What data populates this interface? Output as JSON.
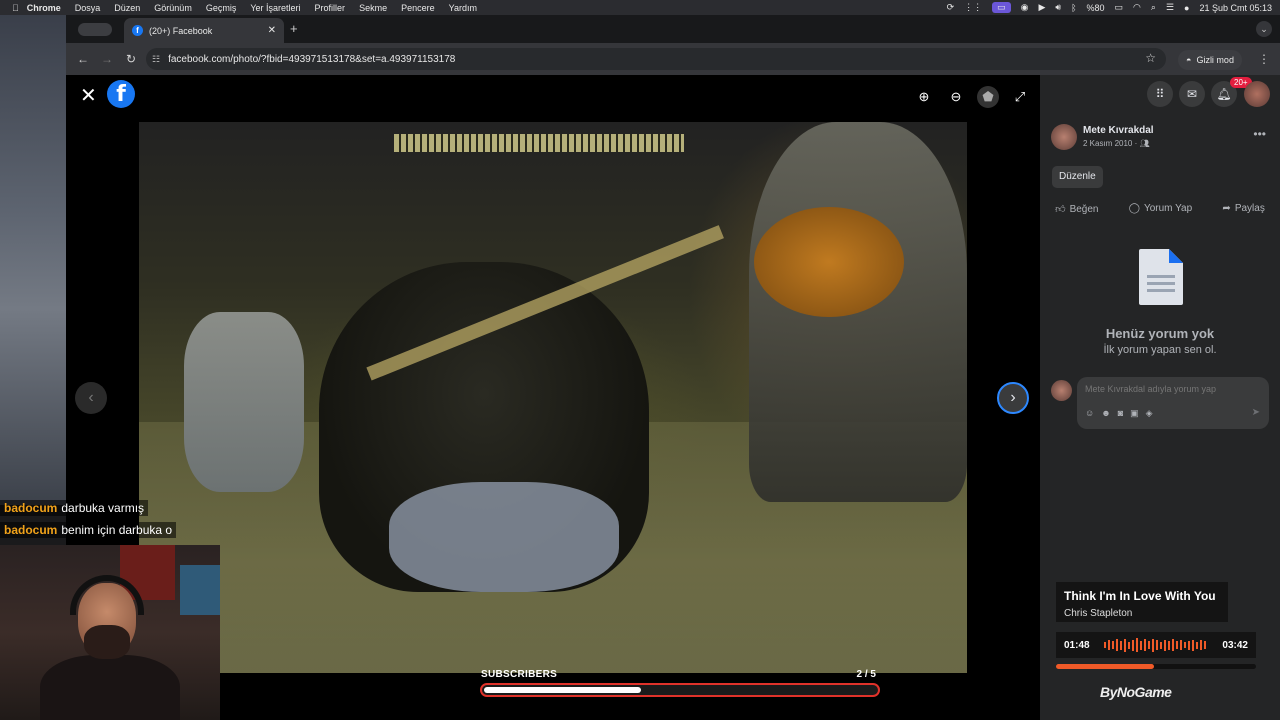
{
  "menubar": {
    "app": "Chrome",
    "items": [
      "Dosya",
      "Düzen",
      "Görünüm",
      "Geçmiş",
      "Yer İşaretleri",
      "Profiller",
      "Sekme",
      "Pencere",
      "Yardım"
    ],
    "battery": "%80",
    "datetime": "21 Şub Cmt  05:13"
  },
  "browser": {
    "tab_title": "(20+) Facebook",
    "url": "facebook.com/photo/?fbid=493971513178&set=a.493971153178",
    "incognito_label": "Gizli mod"
  },
  "post": {
    "author": "Mete Kıvrakdal",
    "date": "2 Kasım 2010 ·",
    "edit_label": "Düzenle",
    "like_label": "Beğen",
    "comment_label": "Yorum Yap",
    "share_label": "Paylaş",
    "no_comments_title": "Henüz yorum yok",
    "no_comments_sub": "İlk yorum yapan sen ol.",
    "comment_placeholder": "Mete Kıvrakdal adıyla yorum yap"
  },
  "header": {
    "notif_badge": "20+"
  },
  "chat": [
    {
      "user": "badocum",
      "message": "darbuka varmış"
    },
    {
      "user": "badocum",
      "message": "benim için darbuka o"
    }
  ],
  "subscribers": {
    "label": "SUBSCRIBERS",
    "count": "2  / 5",
    "progress": 0.4
  },
  "music": {
    "title": "Think I'm In Love With You",
    "artist": "Chris Stapleton",
    "elapsed": "01:48",
    "total": "03:42",
    "progress": 0.49,
    "accent": "#f05a28"
  },
  "brand": "ByNoGame",
  "colors": {
    "fb_blue": "#1877f2",
    "panel_bg": "#242526",
    "badge_red": "#e41e3f"
  }
}
